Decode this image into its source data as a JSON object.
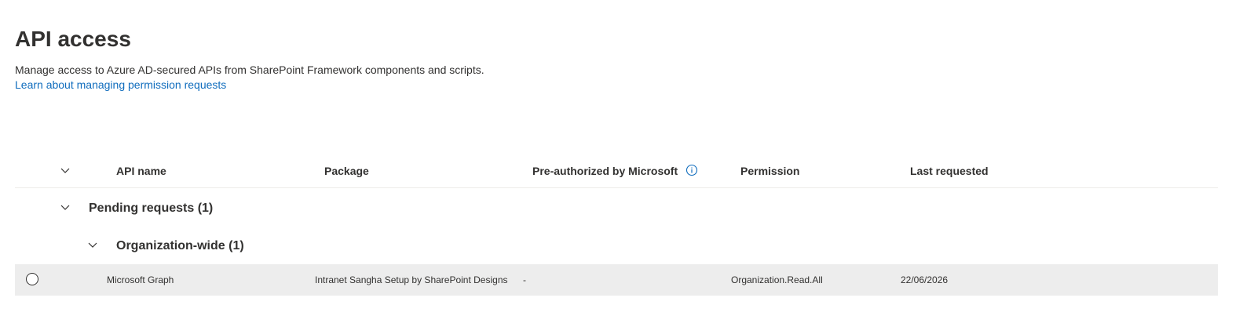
{
  "page": {
    "title": "API access",
    "description": "Manage access to Azure AD-secured APIs from SharePoint Framework components and scripts.",
    "learn_link": "Learn about managing permission requests"
  },
  "table": {
    "columns": {
      "api_name": "API name",
      "package": "Package",
      "pre_authorized": "Pre-authorized by Microsoft",
      "permission": "Permission",
      "last_requested": "Last requested"
    },
    "groups": [
      {
        "label": "Pending requests (1)",
        "subgroups": [
          {
            "label": "Organization-wide (1)",
            "rows": [
              {
                "api_name": "Microsoft Graph",
                "package": "Intranet Sangha Setup by SharePoint Designs",
                "pre_authorized": "-",
                "permission": "Organization.Read.All",
                "last_requested": "22/06/2026"
              }
            ]
          }
        ]
      }
    ]
  },
  "icons": {
    "collapse_all": "chevron-down-icon",
    "info": "info-icon",
    "group_toggle": "chevron-down-icon",
    "row_select": "radio-icon"
  },
  "colors": {
    "link": "#0f6cbd",
    "selected_row": "#ededed",
    "text": "#323130",
    "divider": "#edebe9"
  }
}
